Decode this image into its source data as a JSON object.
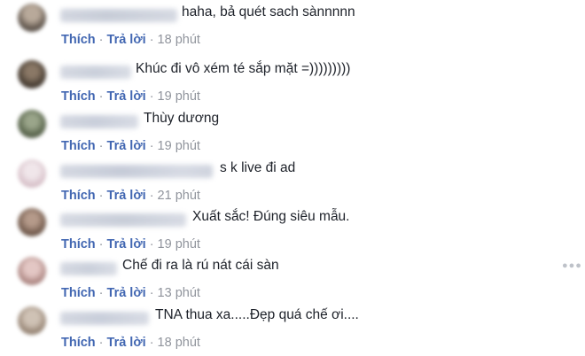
{
  "actions": {
    "like_label": "Thích",
    "reply_label": "Trả lời",
    "separator": "·"
  },
  "comments": [
    {
      "text": "haha, bả quét sach sànnnnn",
      "time": "18 phút"
    },
    {
      "text": "Khúc đi vô xém té sắp mặt =)))))))))",
      "time": "19 phút"
    },
    {
      "text": "Thùy dương",
      "time": "19 phút"
    },
    {
      "text": "s k live đi ad",
      "time": "21 phút"
    },
    {
      "text": "Xuất sắc! Đúng siêu mẫu.",
      "time": "19 phút"
    },
    {
      "text": "Chế đi ra là rú nát cái sàn",
      "time": "13 phút"
    },
    {
      "text": "TNA thua xa.....Đẹp quá chế ơi....",
      "time": "18 phút"
    }
  ],
  "colors": {
    "link": "#4267b2",
    "meta": "#90949c",
    "text": "#1d2129",
    "options_icon": "#bec2c9"
  },
  "icons": {
    "options": "more-options-icon"
  }
}
